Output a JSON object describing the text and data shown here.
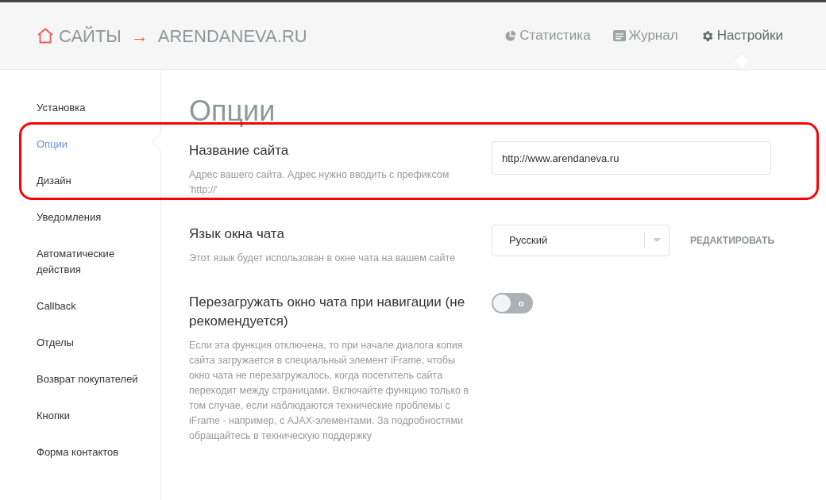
{
  "breadcrumb": {
    "root": "САЙТЫ",
    "separator": "→",
    "current": "ARENDANEVA.RU"
  },
  "top_nav": [
    {
      "label": "Статистика",
      "kind": "stats",
      "selected": false
    },
    {
      "label": "Журнал",
      "kind": "journal",
      "selected": false
    },
    {
      "label": "Настройки",
      "kind": "settings",
      "selected": true
    }
  ],
  "sidebar": {
    "items": [
      {
        "label": "Установка",
        "selected": false
      },
      {
        "label": "Опции",
        "selected": true
      },
      {
        "label": "Дизайн",
        "selected": false
      },
      {
        "label": "Уведомления",
        "selected": false
      },
      {
        "label": "Автоматические действия",
        "selected": false
      },
      {
        "label": "Callback",
        "selected": false
      },
      {
        "label": "Отделы",
        "selected": false
      },
      {
        "label": "Возврат покупателей",
        "selected": false
      },
      {
        "label": "Кнопки",
        "selected": false
      },
      {
        "label": "Форма контактов",
        "selected": false
      }
    ]
  },
  "page_title": "Опции",
  "settings": [
    {
      "kind": "input",
      "title": "Название сайта",
      "description": "Адрес вашего сайта. Адрес нужно вводить с префиксом 'http://'",
      "value": "http://www.arendaneva.ru",
      "highlighted": true
    },
    {
      "kind": "select",
      "title": "Язык окна чата",
      "description": "Этот язык будет использован в окне чата на вашем сайте",
      "value": "Русский",
      "action": "РЕДАКТИРОВАТЬ",
      "highlighted": false
    },
    {
      "kind": "toggle",
      "title": "Перезагружать окно чата при навигации (не рекомендуется)",
      "description": "Если эта функция отключена, то при начале диалога копия сайта загружается в специальный элемент iFrame, чтобы окно чата не перезагружалось, когда посетитель сайта переходит между страницами. Включайте функцию только в том случае, если наблюдаются технические проблемы с iFrame - например, с AJAX-элементами. За подробностями обращайтесь в техническую поддержку",
      "on": false,
      "toggle_text": "o",
      "highlighted": false
    }
  ]
}
